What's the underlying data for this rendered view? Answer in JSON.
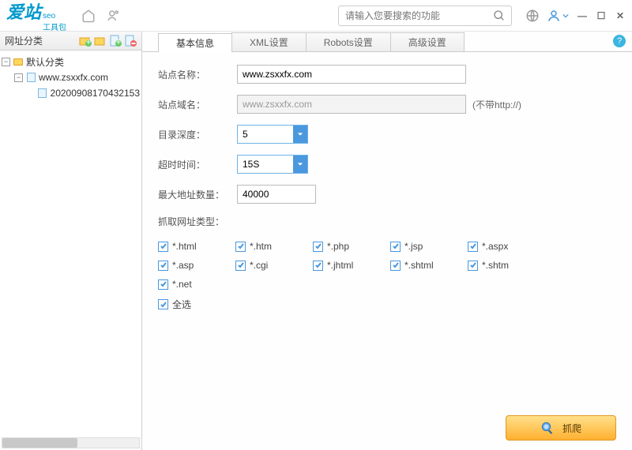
{
  "header": {
    "logo_main": "爱站",
    "logo_seo": "seo",
    "logo_sub": "工具包",
    "search_placeholder": "请输入您要搜索的功能"
  },
  "sidebar": {
    "title": "网址分类",
    "tree": {
      "root": "默认分类",
      "site": "www.zsxxfx.com",
      "entry": "20200908170432153"
    }
  },
  "tabs": [
    "基本信息",
    "XML设置",
    "Robots设置",
    "高级设置"
  ],
  "form": {
    "site_name_label": "站点名称：",
    "site_name_value": "www.zsxxfx.com",
    "site_domain_label": "站点域名：",
    "site_domain_value": "www.zsxxfx.com",
    "site_domain_hint": "(不带http://)",
    "depth_label": "目录深度：",
    "depth_value": "5",
    "timeout_label": "超时时间：",
    "timeout_value": "15S",
    "max_urls_label": "最大地址数量：",
    "max_urls_value": "40000",
    "crawl_types_label": "抓取网址类型："
  },
  "checks": [
    "*.html",
    "*.htm",
    "*.php",
    "*.jsp",
    "*.aspx",
    "*.asp",
    "*.cgi",
    "*.jhtml",
    "*.shtml",
    "*.shtm",
    "*.net",
    "全选"
  ],
  "footer": {
    "crawl_button": "抓爬"
  }
}
